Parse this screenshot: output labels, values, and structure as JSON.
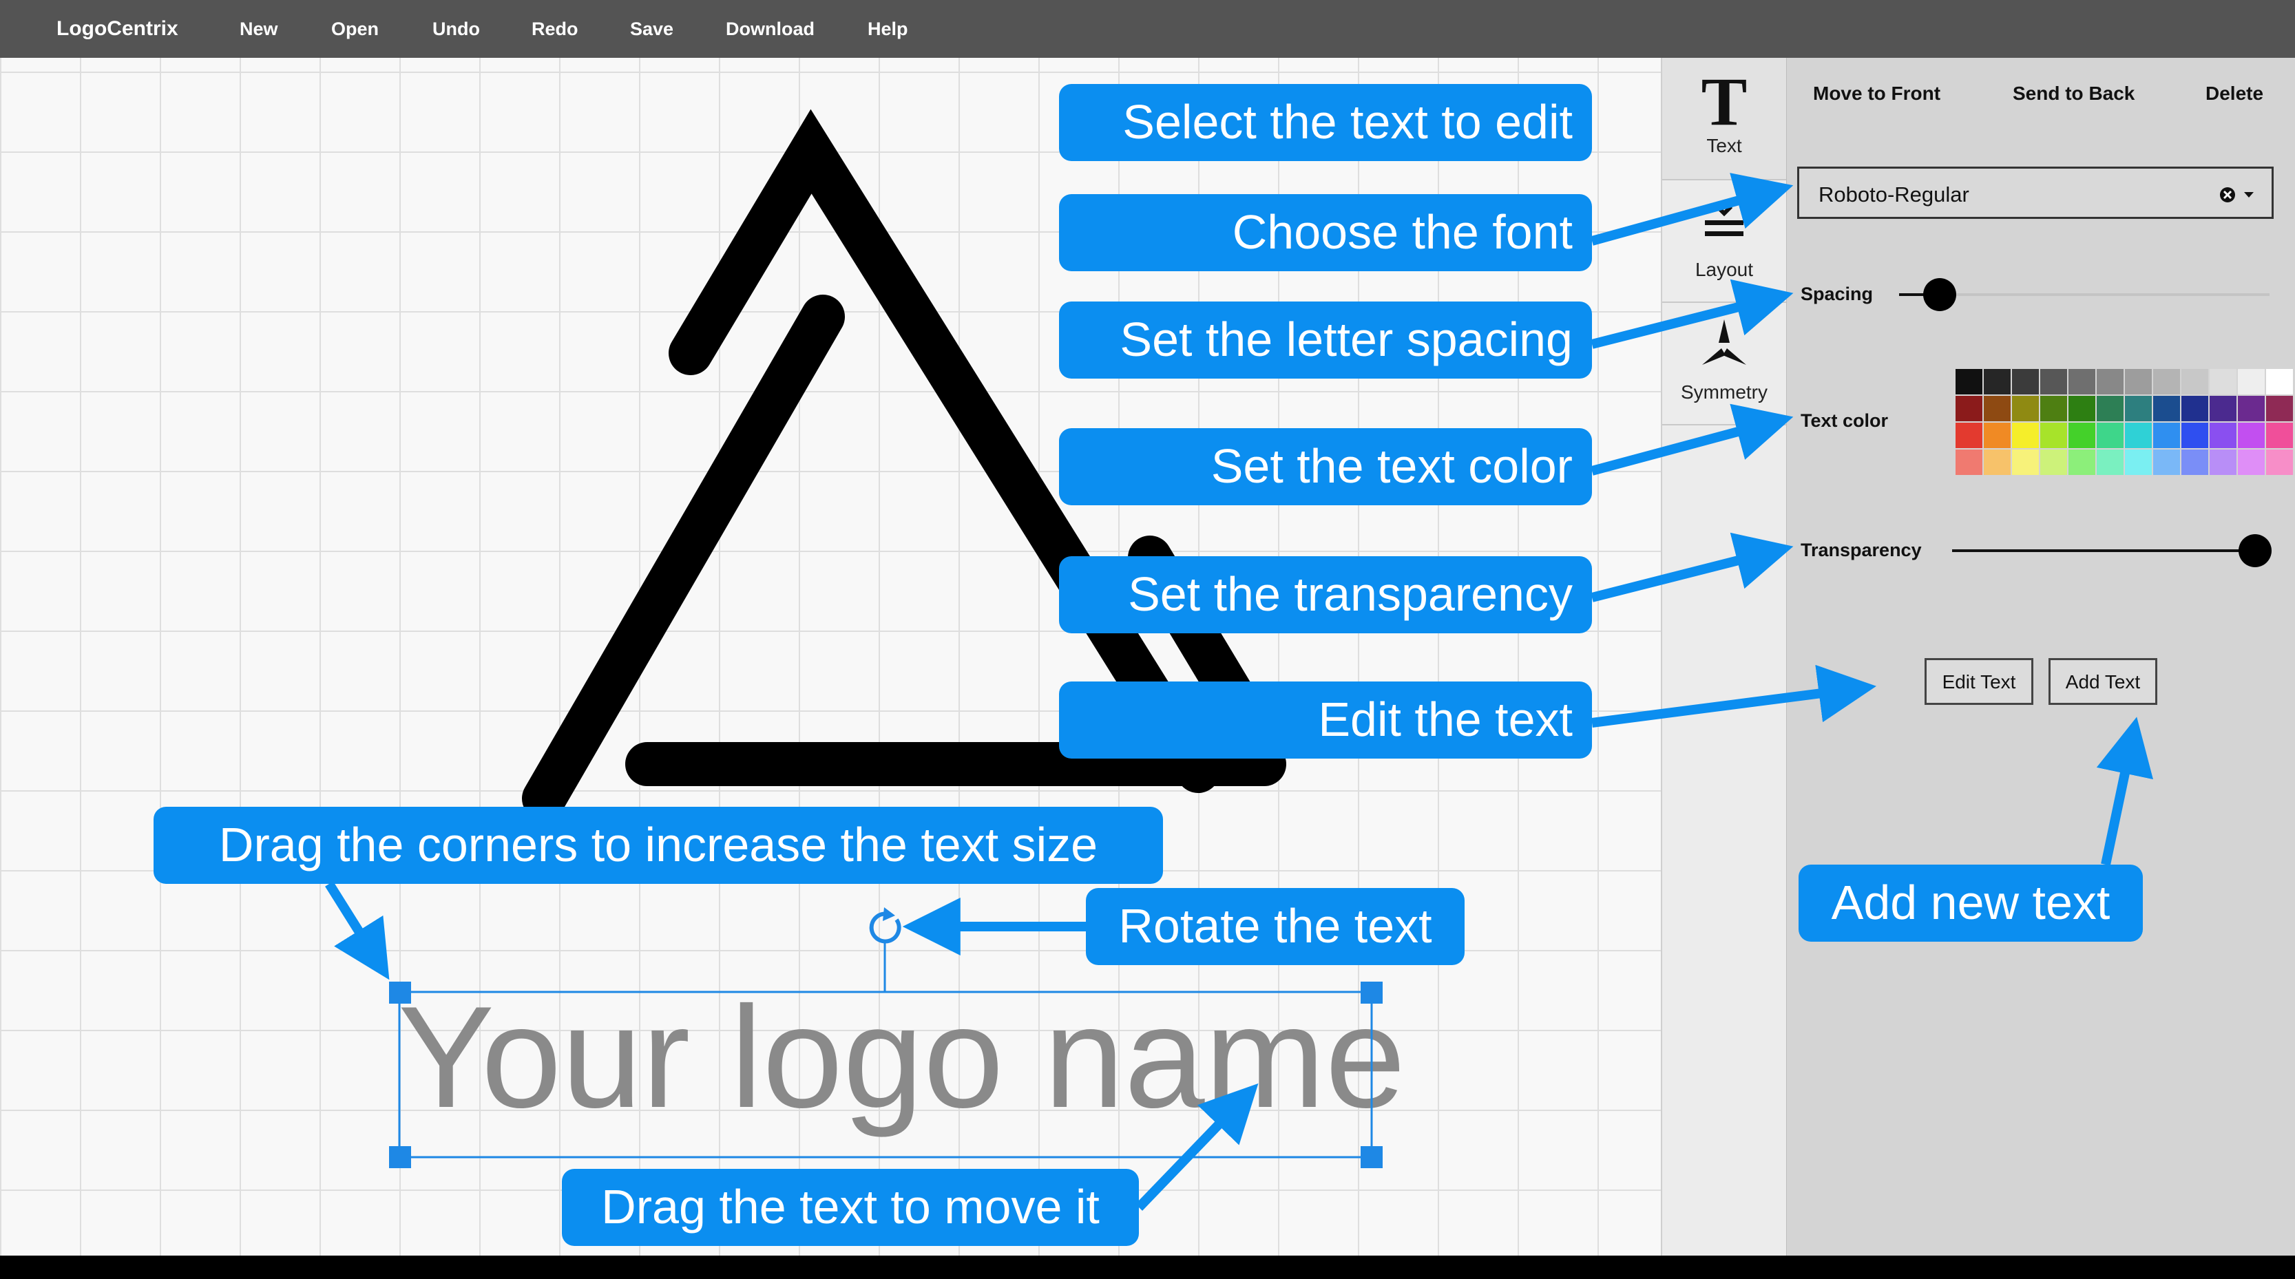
{
  "menu": {
    "brand": "LogoCentrix",
    "items": [
      "New",
      "Open",
      "Undo",
      "Redo",
      "Save",
      "Download",
      "Help"
    ]
  },
  "tools": {
    "text_glyph": "T",
    "text": "Text",
    "layout": "Layout",
    "symmetry": "Symmetry"
  },
  "panel": {
    "move_to_front": "Move to Front",
    "send_to_back": "Send to Back",
    "delete": "Delete",
    "font_value": "Roboto-Regular",
    "spacing_label": "Spacing",
    "spacing_level": 0.11,
    "text_color_label": "Text color",
    "transparency_label": "Transparency",
    "transparency_level": 1.0,
    "edit_text": "Edit Text",
    "add_text": "Add Text",
    "palette": [
      [
        "#111111",
        "#262626",
        "#3b3b3b",
        "#575757",
        "#6f6f6f",
        "#888888",
        "#9d9d9d",
        "#b4b4b4",
        "#c8c8c8",
        "#dddddd",
        "#eeeeee",
        "#ffffff"
      ],
      [
        "#8b1b1b",
        "#8e4a12",
        "#8f8a12",
        "#4e7f12",
        "#2d7f12",
        "#2d7f55",
        "#2d7f7f",
        "#1b4d8f",
        "#20308f",
        "#4b2a8f",
        "#6b2a8f",
        "#8f2a55"
      ],
      [
        "#e33a2f",
        "#f08a24",
        "#f5ee2a",
        "#a7e32a",
        "#44d12a",
        "#3ed68a",
        "#2fd1d6",
        "#2f8ff0",
        "#2f4ff0",
        "#8a4ff0",
        "#c24ff0",
        "#f04f9a"
      ],
      [
        "#f07a70",
        "#f7c26a",
        "#f7f27a",
        "#cdf27a",
        "#8cef7a",
        "#7af0c0",
        "#7aeff2",
        "#7ab8f7",
        "#7a8ef7",
        "#b88ef7",
        "#df8ef7",
        "#f78ec8"
      ]
    ]
  },
  "canvas": {
    "logo_text": "Your logo name",
    "logo_text_color": "#8a8a8a",
    "selection_color": "#1e88e5"
  },
  "callouts": {
    "select_text": "Select the text to edit",
    "choose_font": "Choose the font",
    "letter_spacing": "Set the letter spacing",
    "text_color": "Set the text color",
    "transparency": "Set the transparency",
    "edit_text": "Edit the text",
    "drag_corners": "Drag the corners to increase the text size",
    "rotate": "Rotate the text",
    "drag_move": "Drag the text to move it",
    "add_new": "Add new text"
  },
  "colors": {
    "callout_blue": "#0b8ef0",
    "menubar": "#545454",
    "panel": "#d4d4d4"
  }
}
